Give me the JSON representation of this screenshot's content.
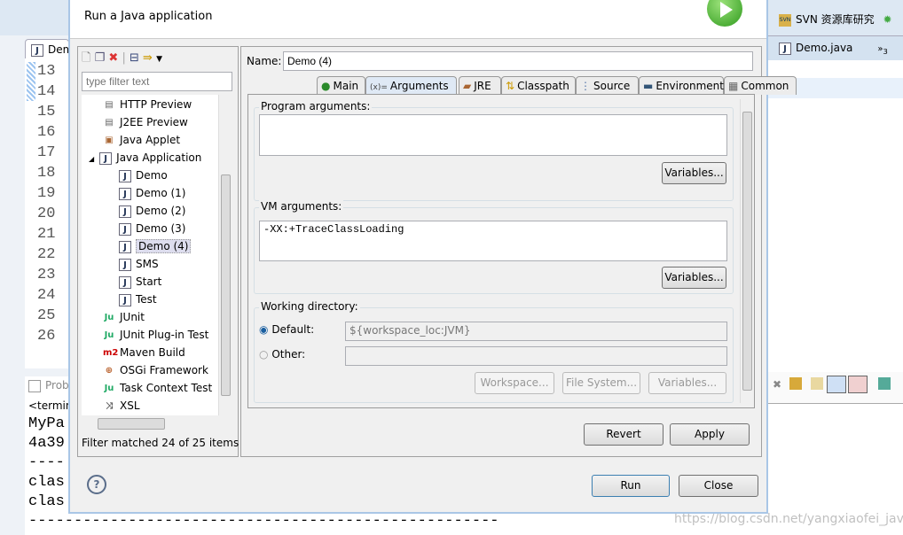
{
  "ide": {
    "editor_tab": "Demo.java",
    "line_numbers": [
      "13",
      "14",
      "15",
      "16",
      "17",
      "18",
      "19",
      "20",
      "21",
      "22",
      "23",
      "24",
      "25",
      "26"
    ],
    "console_tab": "Problems",
    "console_lines": [
      "<terminated>",
      "MyPa",
      "4a39",
      "----",
      "clas",
      "clas",
      "----------------------------------------------------"
    ],
    "svn_perspective": "SVN 资源库研究",
    "right_editor_tab": "Demo.java",
    "overflow_count": "3",
    "watermark": "https://blog.csdn.net/yangxiaofei_java"
  },
  "dialog": {
    "subtitle": "Run a Java application",
    "filter_placeholder": "type filter text",
    "tree": [
      {
        "label": "HTTP Preview",
        "level": 1,
        "icon": "server-icon"
      },
      {
        "label": "J2EE Preview",
        "level": 1,
        "icon": "server-icon"
      },
      {
        "label": "Java Applet",
        "level": 1,
        "icon": "applet-icon"
      },
      {
        "label": "Java Application",
        "level": 1,
        "icon": "java-app-icon",
        "expanded": true
      },
      {
        "label": "Demo",
        "level": 2,
        "icon": "java-file-icon"
      },
      {
        "label": "Demo (1)",
        "level": 2,
        "icon": "java-file-icon"
      },
      {
        "label": "Demo (2)",
        "level": 2,
        "icon": "java-file-icon"
      },
      {
        "label": "Demo (3)",
        "level": 2,
        "icon": "java-file-icon"
      },
      {
        "label": "Demo (4)",
        "level": 2,
        "icon": "java-file-icon",
        "selected": true
      },
      {
        "label": "SMS",
        "level": 2,
        "icon": "java-file-icon"
      },
      {
        "label": "Start",
        "level": 2,
        "icon": "java-file-icon"
      },
      {
        "label": "Test",
        "level": 2,
        "icon": "java-file-icon"
      },
      {
        "label": "JUnit",
        "level": 1,
        "icon": "junit-icon"
      },
      {
        "label": "JUnit Plug-in Test",
        "level": 1,
        "icon": "junit-icon"
      },
      {
        "label": "Maven Build",
        "level": 1,
        "icon": "maven-icon"
      },
      {
        "label": "OSGi Framework",
        "level": 1,
        "icon": "osgi-icon"
      },
      {
        "label": "Task Context Test",
        "level": 1,
        "icon": "junit-icon"
      },
      {
        "label": "XSL",
        "level": 1,
        "icon": "xsl-icon"
      }
    ],
    "filter_status": "Filter matched 24 of 25 items",
    "name_label": "Name:",
    "name_value": "Demo (4)",
    "tabs": [
      {
        "label": "Main",
        "icon": "main-icon"
      },
      {
        "label": "Arguments",
        "icon": "arguments-icon",
        "active": true
      },
      {
        "label": "JRE",
        "icon": "jre-icon"
      },
      {
        "label": "Classpath",
        "icon": "classpath-icon"
      },
      {
        "label": "Source",
        "icon": "source-icon"
      },
      {
        "label": "Environment",
        "icon": "environment-icon"
      },
      {
        "label": "Common",
        "icon": "common-icon"
      }
    ],
    "program_args_label": "Program arguments:",
    "program_args_value": "",
    "vm_args_label": "VM arguments:",
    "vm_args_value": "-XX:+TraceClassLoading",
    "variables_label": "Variables...",
    "working_dir_label": "Working directory:",
    "default_label": "Default:",
    "default_value": "${workspace_loc:JVM}",
    "other_label": "Other:",
    "other_value": "",
    "workspace_label": "Workspace...",
    "filesystem_label": "File System...",
    "revert_label": "Revert",
    "apply_label": "Apply",
    "run_label": "Run",
    "close_label": "Close"
  }
}
